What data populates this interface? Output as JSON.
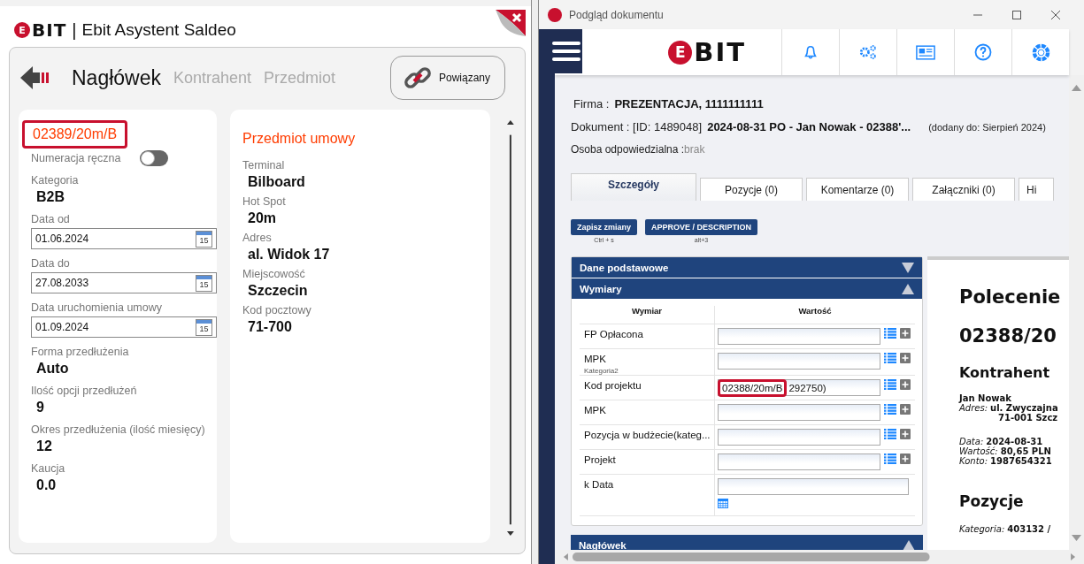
{
  "left_window": {
    "logo": {
      "badge": "E",
      "rest": "BIT"
    },
    "separator": "|",
    "title": "Ebit Asystent Saldeo",
    "tabs": [
      {
        "label": "Nagłówek",
        "selected": true
      },
      {
        "label": "Kontrahent",
        "selected": false
      },
      {
        "label": "Przedmiot",
        "selected": false
      }
    ],
    "linked_button": "Powiązany",
    "document_number": {
      "text": "02389/20m/B",
      "highlighted": true
    },
    "manual_numbering": {
      "label": "Numeracja ręczna",
      "on": false
    },
    "fields": [
      {
        "kind": "text",
        "label": "Kategoria",
        "value": "B2B"
      },
      {
        "kind": "date",
        "label": "Data od",
        "value": "01.06.2024",
        "icon_day": "15"
      },
      {
        "kind": "date",
        "label": "Data do",
        "value": "27.08.2033",
        "icon_day": "15"
      },
      {
        "kind": "date",
        "label": "Data uruchomienia umowy",
        "value": "01.09.2024",
        "icon_day": "15"
      },
      {
        "kind": "text",
        "label": "Forma przedłużenia",
        "value": "Auto"
      },
      {
        "kind": "text",
        "label": "Ilość opcji przedłużeń",
        "value": "9"
      },
      {
        "kind": "text",
        "label": "Okres przedłużenia (ilość miesięcy)",
        "value": "12"
      },
      {
        "kind": "text",
        "label": "Kaucja",
        "value": "0.0"
      }
    ],
    "subject": {
      "title": "Przedmiot umowy",
      "fields": [
        {
          "label": "Terminal",
          "value": "Bilboard"
        },
        {
          "label": "Hot Spot",
          "value": "20m"
        },
        {
          "label": "Adres",
          "value": "al. Widok 17"
        },
        {
          "label": "Miejscowość",
          "value": "Szczecin"
        },
        {
          "label": "Kod pocztowy",
          "value": "71-700"
        }
      ]
    }
  },
  "right_window": {
    "title": "Podgląd dokumentu",
    "logo": {
      "badge": "E",
      "rest": "BIT"
    },
    "firm": {
      "label": "Firma :",
      "value": "PREZENTACJA, 1111111111"
    },
    "document": {
      "label": "Dokument : [ID: 1489048]",
      "value": "2024-08-31 PO - Jan Nowak - 02388'...",
      "added": "(dodany do: Sierpień 2024)"
    },
    "responsible": {
      "label": "Osoba odpowiedzialna :",
      "value": "brak"
    },
    "tabs": [
      {
        "label": "Szczegóły",
        "selected": true
      },
      {
        "label": "Pozycje (0)",
        "selected": false
      },
      {
        "label": "Komentarze (0)",
        "selected": false
      },
      {
        "label": "Załączniki (0)",
        "selected": false
      },
      {
        "label": "Hi",
        "selected": false
      }
    ],
    "actions": [
      {
        "label": "Zapisz zmiany",
        "shortcut": "Ctrl + s"
      },
      {
        "label": "APPROVE / DESCRIPTION",
        "shortcut": "alt+3"
      }
    ],
    "sections": [
      {
        "title": "Dane podstawowe",
        "expanded": false
      },
      {
        "title": "Wymiary",
        "expanded": true
      }
    ],
    "dimensions": {
      "columns": [
        "Wymiar",
        "Wartość"
      ],
      "rows": [
        {
          "kind": "lookup",
          "name": "FP Opłacona"
        },
        {
          "kind": "lookup",
          "name": "MPK",
          "subtitle": "Kategoria2"
        },
        {
          "kind": "lookup",
          "name": "Kod projektu",
          "value": "02388/20m/B",
          "value_rest": "292750)",
          "highlighted": true
        },
        {
          "kind": "lookup",
          "name": "MPK"
        },
        {
          "kind": "lookup",
          "name": "Pozycja w budżecie(kateg..."
        },
        {
          "kind": "lookup",
          "name": "Projekt"
        },
        {
          "kind": "date",
          "name": "k Data"
        }
      ]
    },
    "bottom_section": {
      "title": "Nagłówek",
      "expanded": true
    },
    "preview": {
      "title": "Polecenie",
      "number": "02388/20",
      "contractor_heading": "Kontrahent",
      "contractor": "Jan Nowak",
      "address_label": "Adres:",
      "address": "ul. Zwyczajna",
      "address_city": "71-001 Szcz",
      "details": [
        {
          "label": "Data:",
          "value": "2024-08-31"
        },
        {
          "label": "Wartość:",
          "value": "80,65 PLN"
        },
        {
          "label": "Konto:",
          "value": "1987654321"
        }
      ],
      "items_heading": "Pozycje",
      "category_label": "Kategoria:",
      "category": "403132 /"
    }
  }
}
